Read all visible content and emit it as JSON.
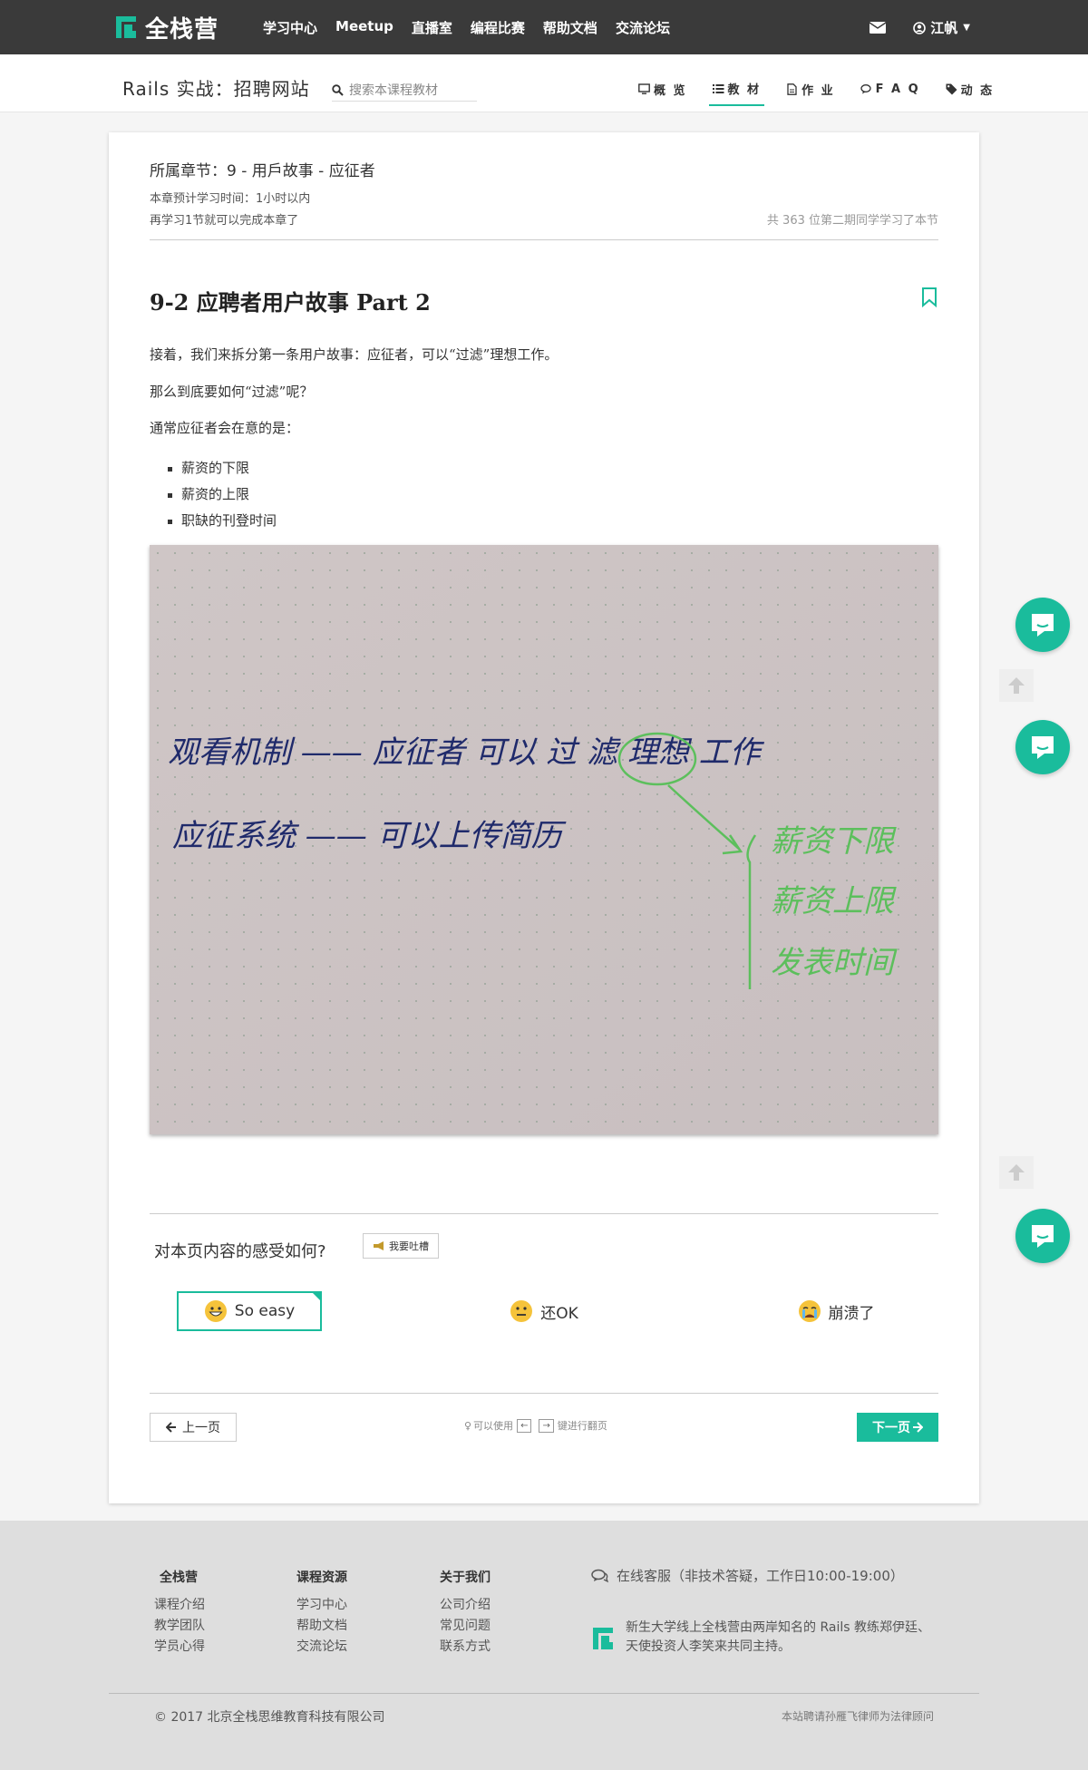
{
  "brand": {
    "name": "全栈营",
    "accent": "#1abc9c"
  },
  "topnav": {
    "links": [
      "学习中心",
      "Meetup",
      "直播室",
      "编程比赛",
      "帮助文档",
      "交流论坛"
    ],
    "user_name": "江帆"
  },
  "course": {
    "title": "Rails 实战：招聘网站",
    "search_placeholder": "搜索本课程教材",
    "tabs": [
      {
        "label": "概 览",
        "icon": "monitor-icon"
      },
      {
        "label": "教 材",
        "icon": "list-icon",
        "active": true
      },
      {
        "label": "作 业",
        "icon": "file-icon"
      },
      {
        "label": "F A Q",
        "icon": "comments-icon"
      },
      {
        "label": "动 态",
        "icon": "tag-icon"
      }
    ]
  },
  "lesson": {
    "chapter": "所属章节：9 - 用戶故事 - 应征者",
    "study_time": "本章预计学习时间：1小时以内",
    "remaining": "再学习1节就可以完成本章了",
    "learners": "共 363 位第二期同学学习了本节",
    "title": "9-2 应聘者用户故事 Part 2",
    "paragraphs": [
      "接着，我们来拆分第一条用户故事：应征者，可以“过滤”理想工作。",
      "那么到底要如何“过滤”呢？",
      "通常应征者会在意的是："
    ],
    "bullets": [
      "薪资的下限",
      "薪资的上限",
      "职缺的刊登时间"
    ],
    "photo_lines": {
      "line1": "观看机制 —— 应征者 可以 过 滤 理想 工作",
      "line2": "应征系统 —— 可以上传简历",
      "green": [
        "薪资下限",
        "薪资上限",
        "发表时间"
      ]
    }
  },
  "feedback": {
    "question": "对本页内容的感受如何?",
    "complain_label": "我要吐槽",
    "reactions": [
      {
        "label": "So easy",
        "icon": "grin-emoji-icon",
        "selected": true
      },
      {
        "label": "还OK",
        "icon": "neutral-emoji-icon"
      },
      {
        "label": "崩溃了",
        "icon": "crying-emoji-icon"
      }
    ]
  },
  "pager": {
    "prev_label": "上一页",
    "next_label": "下一页",
    "hint_pre": "可以使用",
    "key_left": "←",
    "key_right": "→",
    "hint_post": "键进行翻页"
  },
  "footer": {
    "columns": [
      {
        "heading": "全栈营",
        "links": [
          "课程介绍",
          "教学团队",
          "学员心得"
        ]
      },
      {
        "heading": "课程资源",
        "links": [
          "学习中心",
          "帮助文档",
          "交流论坛"
        ]
      },
      {
        "heading": "关于我们",
        "links": [
          "公司介绍",
          "常见问题",
          "联系方式"
        ]
      }
    ],
    "service": "在线客服（非技术答疑，工作日10:00-19:00）",
    "about": "新生大学线上全栈营由两岸知名的 Rails 教练郑伊廷、天使投资人李笑来共同主持。",
    "copyright": "© 2017 北京全栈思维教育科技有限公司",
    "legal": "本站聘请孙雁飞律师为法律顾问"
  }
}
